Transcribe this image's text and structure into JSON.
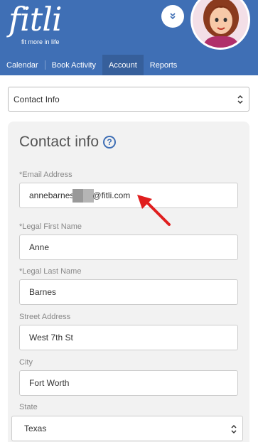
{
  "header": {
    "logo": "fitli",
    "tagline": "fit more in life",
    "nav": [
      {
        "label": "Calendar",
        "active": false
      },
      {
        "label": "Book Activity",
        "active": false
      },
      {
        "label": "Account",
        "active": true
      },
      {
        "label": "Reports",
        "active": false
      }
    ]
  },
  "section_select": {
    "value": "Contact Info"
  },
  "card": {
    "title": "Contact info",
    "help_icon": "?"
  },
  "fields": {
    "email": {
      "label": "*Email Address",
      "value_prefix": "annebarnes",
      "value_suffix": "@fitli.com"
    },
    "first_name": {
      "label": "*Legal First Name",
      "value": "Anne"
    },
    "last_name": {
      "label": "*Legal Last Name",
      "value": "Barnes"
    },
    "street": {
      "label": "Street Address",
      "value": "West 7th St"
    },
    "city": {
      "label": "City",
      "value": "Fort Worth"
    },
    "state": {
      "label": "State",
      "value": "Texas"
    }
  },
  "colors": {
    "brand": "#3f6fb5",
    "nav_active": "#365f9b",
    "annotation": "#e01e1e"
  }
}
